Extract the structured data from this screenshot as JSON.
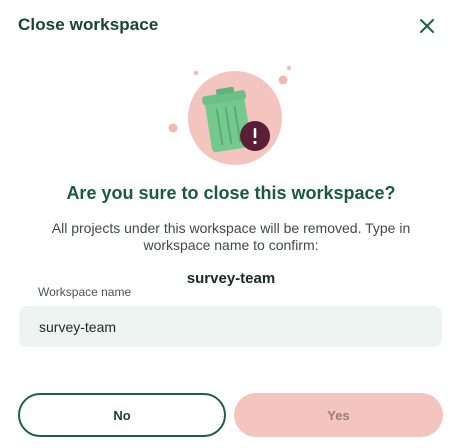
{
  "dialog": {
    "title": "Close workspace",
    "heading": "Are you sure to close this workspace?",
    "description": "All projects under this workspace will be removed. Type in workspace name to confirm:",
    "workspace_name": "survey-team",
    "field": {
      "label": "Workspace name",
      "value": "survey-team"
    },
    "buttons": {
      "no_label": "No",
      "yes_label": "Yes"
    },
    "icons": {
      "close": "close-icon",
      "illustration": "trash-bin-warning-icon",
      "alert": "exclamation-icon"
    },
    "colors": {
      "primary": "#1f5e49",
      "danger_soft": "#f3c5be",
      "bin_green": "#74c98f",
      "alert_badge": "#5a1f35",
      "input_bg": "#eef4f2"
    }
  }
}
